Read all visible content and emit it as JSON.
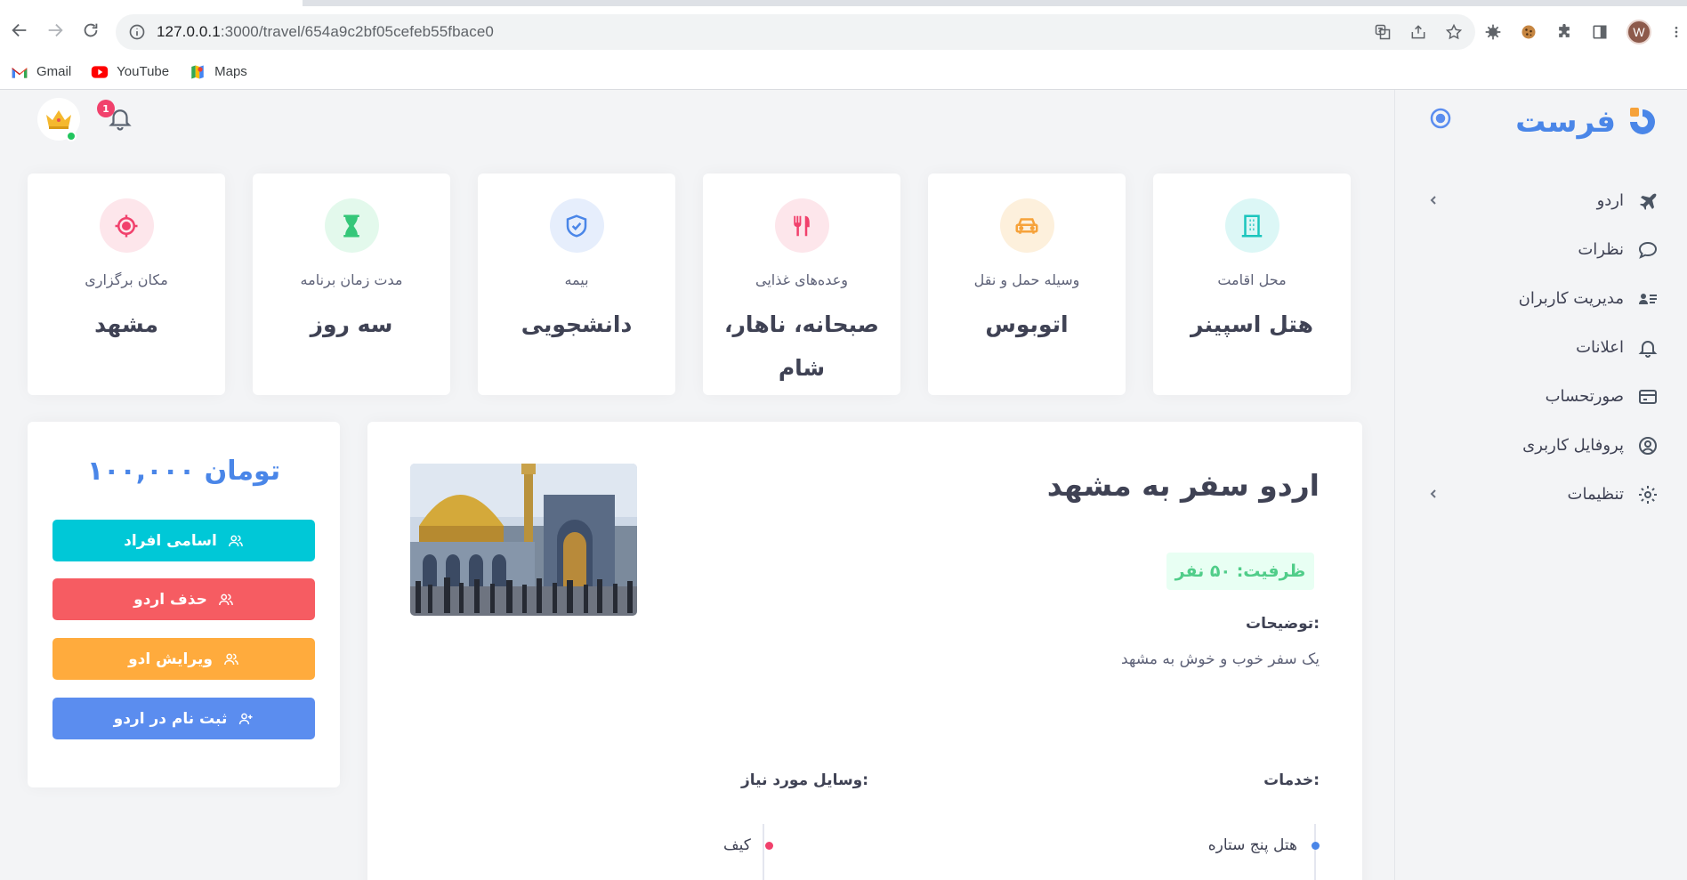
{
  "browser": {
    "url_host": "127.0.0.1",
    "url_rest": ":3000/travel/654a9c2bf05cefeb55fbace0",
    "profile_initial": "W",
    "bookmarks": [
      {
        "label": "Gmail",
        "icon": "gmail-icon"
      },
      {
        "label": "YouTube",
        "icon": "youtube-icon"
      },
      {
        "label": "Maps",
        "icon": "maps-icon"
      }
    ]
  },
  "brand": {
    "name": "فرست"
  },
  "sidebar": {
    "items": [
      {
        "label": "اردو",
        "icon": "airplane-icon",
        "has_submenu": true
      },
      {
        "label": "نظرات",
        "icon": "comment-icon",
        "has_submenu": false
      },
      {
        "label": "مدیریت کاربران",
        "icon": "user-list-icon",
        "has_submenu": false
      },
      {
        "label": "اعلانات",
        "icon": "bell-icon",
        "has_submenu": false
      },
      {
        "label": "صورتحساب",
        "icon": "card-icon",
        "has_submenu": false
      },
      {
        "label": "پروفایل کاربری",
        "icon": "user-circle-icon",
        "has_submenu": false
      },
      {
        "label": "تنظیمات",
        "icon": "gear-icon",
        "has_submenu": true
      }
    ]
  },
  "header": {
    "notification_count": "1"
  },
  "stats": [
    {
      "caption": "محل اقامت",
      "value": "هتل اسپینر",
      "icon": "building-icon",
      "color": "#1bc5bd",
      "bg": "#dcf7f6"
    },
    {
      "caption": "وسیله حمل و نقل",
      "value": "اتوبوس",
      "icon": "car-icon",
      "color": "#f6a23a",
      "bg": "#fdf0dc"
    },
    {
      "caption": "وعده‌های غذایی",
      "value": "صبحانه، ناهار، شام",
      "icon": "utensils-icon",
      "color": "#f1416c",
      "bg": "#fde6eb"
    },
    {
      "caption": "بیمه",
      "value": "دانشجویی",
      "icon": "shield-icon",
      "color": "#4a86e8",
      "bg": "#e6eefc"
    },
    {
      "caption": "مدت زمان برنامه",
      "value": "سه روز",
      "icon": "hourglass-icon",
      "color": "#35c779",
      "bg": "#e3f9ec"
    },
    {
      "caption": "مکان برگزاری",
      "value": "مشهد",
      "icon": "target-icon",
      "color": "#f1416c",
      "bg": "#fde6eb"
    }
  ],
  "price": {
    "text": "۱۰۰,۰۰۰ تومان"
  },
  "actions": [
    {
      "label": "اسامی افراد",
      "color": "#00c8d7"
    },
    {
      "label": "حذف اردو",
      "color": "#f65c62"
    },
    {
      "label": "ویرایش ادو",
      "color": "#ffab3d"
    },
    {
      "label": "ثبت نام در اردو",
      "color": "#5b8def"
    }
  ],
  "detail": {
    "title": "اردو سفر به مشهد",
    "capacity": "ظرفیت: ۵۰ نفر",
    "desc_label": "توضیحات:",
    "desc_text": "یک سفر خوب و خوش به مشهد",
    "services_label": "خدمات:",
    "needs_label": "وسایل مورد نیاز:",
    "services": [
      "هتل پنج ستاره"
    ],
    "needs": [
      "کیف"
    ]
  }
}
